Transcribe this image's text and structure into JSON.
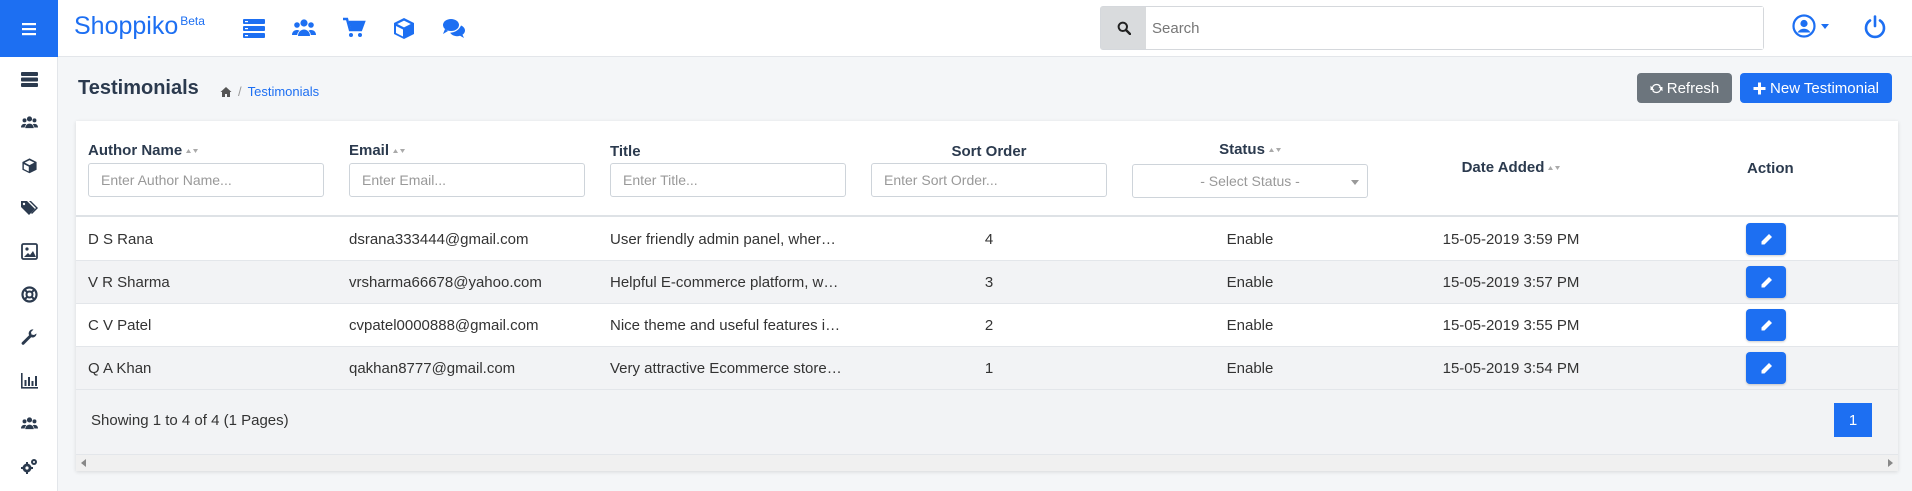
{
  "app": {
    "name": "Shoppiko",
    "badge": "Beta"
  },
  "topnav": {
    "icons": [
      "dashboard-icon",
      "customers-icon",
      "cart-icon",
      "cube-icon",
      "comments-icon"
    ],
    "search_placeholder": "Search"
  },
  "sidebar": {
    "items": [
      "dashboard-icon",
      "users-icon",
      "cube-icon",
      "tags-icon",
      "image-icon",
      "lifebuoy-icon",
      "wrench-icon",
      "bar-chart-icon",
      "users-group-icon",
      "cogs-icon"
    ]
  },
  "page": {
    "title": "Testimonials",
    "breadcrumb": [
      "Testimonials"
    ],
    "refresh_label": "Refresh",
    "new_label": "New Testimonial"
  },
  "table": {
    "columns": {
      "author": "Author Name",
      "email": "Email",
      "title": "Title",
      "sort_order": "Sort Order",
      "status": "Status",
      "date_added": "Date Added",
      "action": "Action"
    },
    "filters": {
      "author": "Enter Author Name...",
      "email": "Enter Email...",
      "title": "Enter Title...",
      "sort_order": "Enter Sort Order...",
      "status": "- Select Status -"
    },
    "rows": [
      {
        "author": "D S Rana",
        "email": "dsrana333444@gmail.com",
        "title": "User friendly admin panel, wher…",
        "sort_order": "4",
        "status": "Enable",
        "date": "15-05-2019 3:59 PM"
      },
      {
        "author": "V R Sharma",
        "email": "vrsharma66678@yahoo.com",
        "title": "Helpful E-commerce platform, w…",
        "sort_order": "3",
        "status": "Enable",
        "date": "15-05-2019 3:57 PM"
      },
      {
        "author": "C V Patel",
        "email": "cvpatel0000888@gmail.com",
        "title": "Nice theme and useful features i…",
        "sort_order": "2",
        "status": "Enable",
        "date": "15-05-2019 3:55 PM"
      },
      {
        "author": "Q A Khan",
        "email": "qakhan8777@gmail.com",
        "title": "Very attractive Ecommerce store…",
        "sort_order": "1",
        "status": "Enable",
        "date": "15-05-2019 3:54 PM"
      }
    ],
    "footer_text": "Showing 1 to 4 of 4 (1 Pages)",
    "current_page": "1"
  },
  "colors": {
    "primary": "#1d6ff2",
    "secondary": "#6c757d",
    "text_dark": "#2b3a4e"
  }
}
